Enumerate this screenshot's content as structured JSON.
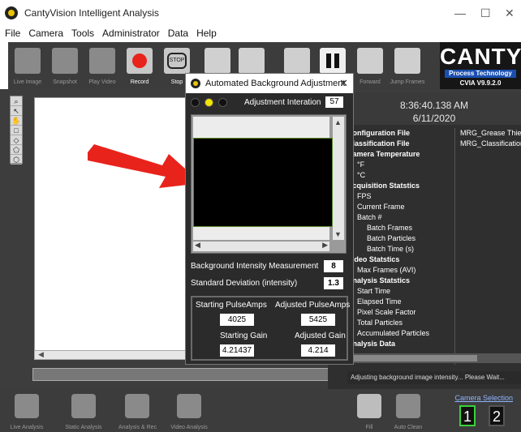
{
  "window": {
    "title": "CantyVision Intelligent Analysis",
    "minimize": "—",
    "maximize": "☐",
    "close": "✕"
  },
  "menu": [
    "File",
    "Camera",
    "Tools",
    "Administrator",
    "Data",
    "Help"
  ],
  "toolbar": {
    "buttons": [
      "Live Image",
      "Snapshot",
      "Play Video",
      "Record",
      "Stop",
      "",
      "",
      "",
      "",
      "",
      "Forward",
      "Jump Frames"
    ]
  },
  "logo": {
    "brand": "CANTY",
    "tagline": "Process Technology",
    "version": "CVIA V9.9.2.0"
  },
  "clock": {
    "time": "8:36:40.138 AM",
    "date": "6/11/2020"
  },
  "tree": {
    "items": [
      {
        "label": "Configuration File",
        "level": 0,
        "bold": true
      },
      {
        "label": "Classification File",
        "level": 0,
        "bold": true
      },
      {
        "label": "Camera Temperature",
        "level": 0,
        "bold": true
      },
      {
        "label": "°F",
        "level": 1,
        "bold": false
      },
      {
        "label": "°C",
        "level": 1,
        "bold": false
      },
      {
        "label": "Acquisition Statstics",
        "level": 0,
        "bold": true
      },
      {
        "label": "FPS",
        "level": 1,
        "bold": false
      },
      {
        "label": "Current Frame",
        "level": 1,
        "bold": false
      },
      {
        "label": "Batch #",
        "level": 1,
        "bold": false
      },
      {
        "label": "Batch Frames",
        "level": 2,
        "bold": false
      },
      {
        "label": "Batch Particles",
        "level": 2,
        "bold": false
      },
      {
        "label": "Batch Time (s)",
        "level": 2,
        "bold": false
      },
      {
        "label": "Video Statstics",
        "level": 0,
        "bold": true
      },
      {
        "label": "Max Frames (AVI)",
        "level": 1,
        "bold": false
      },
      {
        "label": "Analysis Statstics",
        "level": 0,
        "bold": true
      },
      {
        "label": "Start Time",
        "level": 1,
        "bold": false
      },
      {
        "label": "Elapsed Time",
        "level": 1,
        "bold": false
      },
      {
        "label": "Pixel Scale Factor",
        "level": 1,
        "bold": false
      },
      {
        "label": "Total Particles",
        "level": 1,
        "bold": false
      },
      {
        "label": "Accumulated Particles",
        "level": 1,
        "bold": false
      },
      {
        "label": "Analysis Data",
        "level": 0,
        "bold": true
      }
    ],
    "values": [
      "MRG_Grease Thief_Cl",
      "MRG_Classification.cl"
    ]
  },
  "status": {
    "message": "Adjusting background image intensity... Please Wait..."
  },
  "bottom": {
    "buttons": [
      "Live Analysis",
      "Static Analysis",
      "Analysis & Rec",
      "Video Analysis",
      "Fill",
      "Auto Clean"
    ]
  },
  "camera": {
    "label": "Camera Selection",
    "options": [
      "1",
      "2"
    ],
    "selected": "1"
  },
  "dialog": {
    "title": "Automated Background Adjustment",
    "close": "✕",
    "iteration_label": "Adjustment Interation",
    "iteration_value": "57",
    "intensity_label": "Background Intensity Measurement",
    "intensity_value": "8",
    "stddev_label": "Standard Deviation (intensity)",
    "stddev_value": "1.3",
    "start_pulse_label": "Starting PulseAmps",
    "start_pulse_value": "4025",
    "adj_pulse_label": "Adjusted PulseAmps",
    "adj_pulse_value": "5425",
    "start_gain_label": "Starting Gain",
    "start_gain_value": "4.21437",
    "adj_gain_label": "Adjusted Gain",
    "adj_gain_value": "4.214"
  },
  "colors": {
    "accent_red": "#e8231c",
    "led_yellow": "#f2e600",
    "camera_selected": "#3bd13b"
  }
}
